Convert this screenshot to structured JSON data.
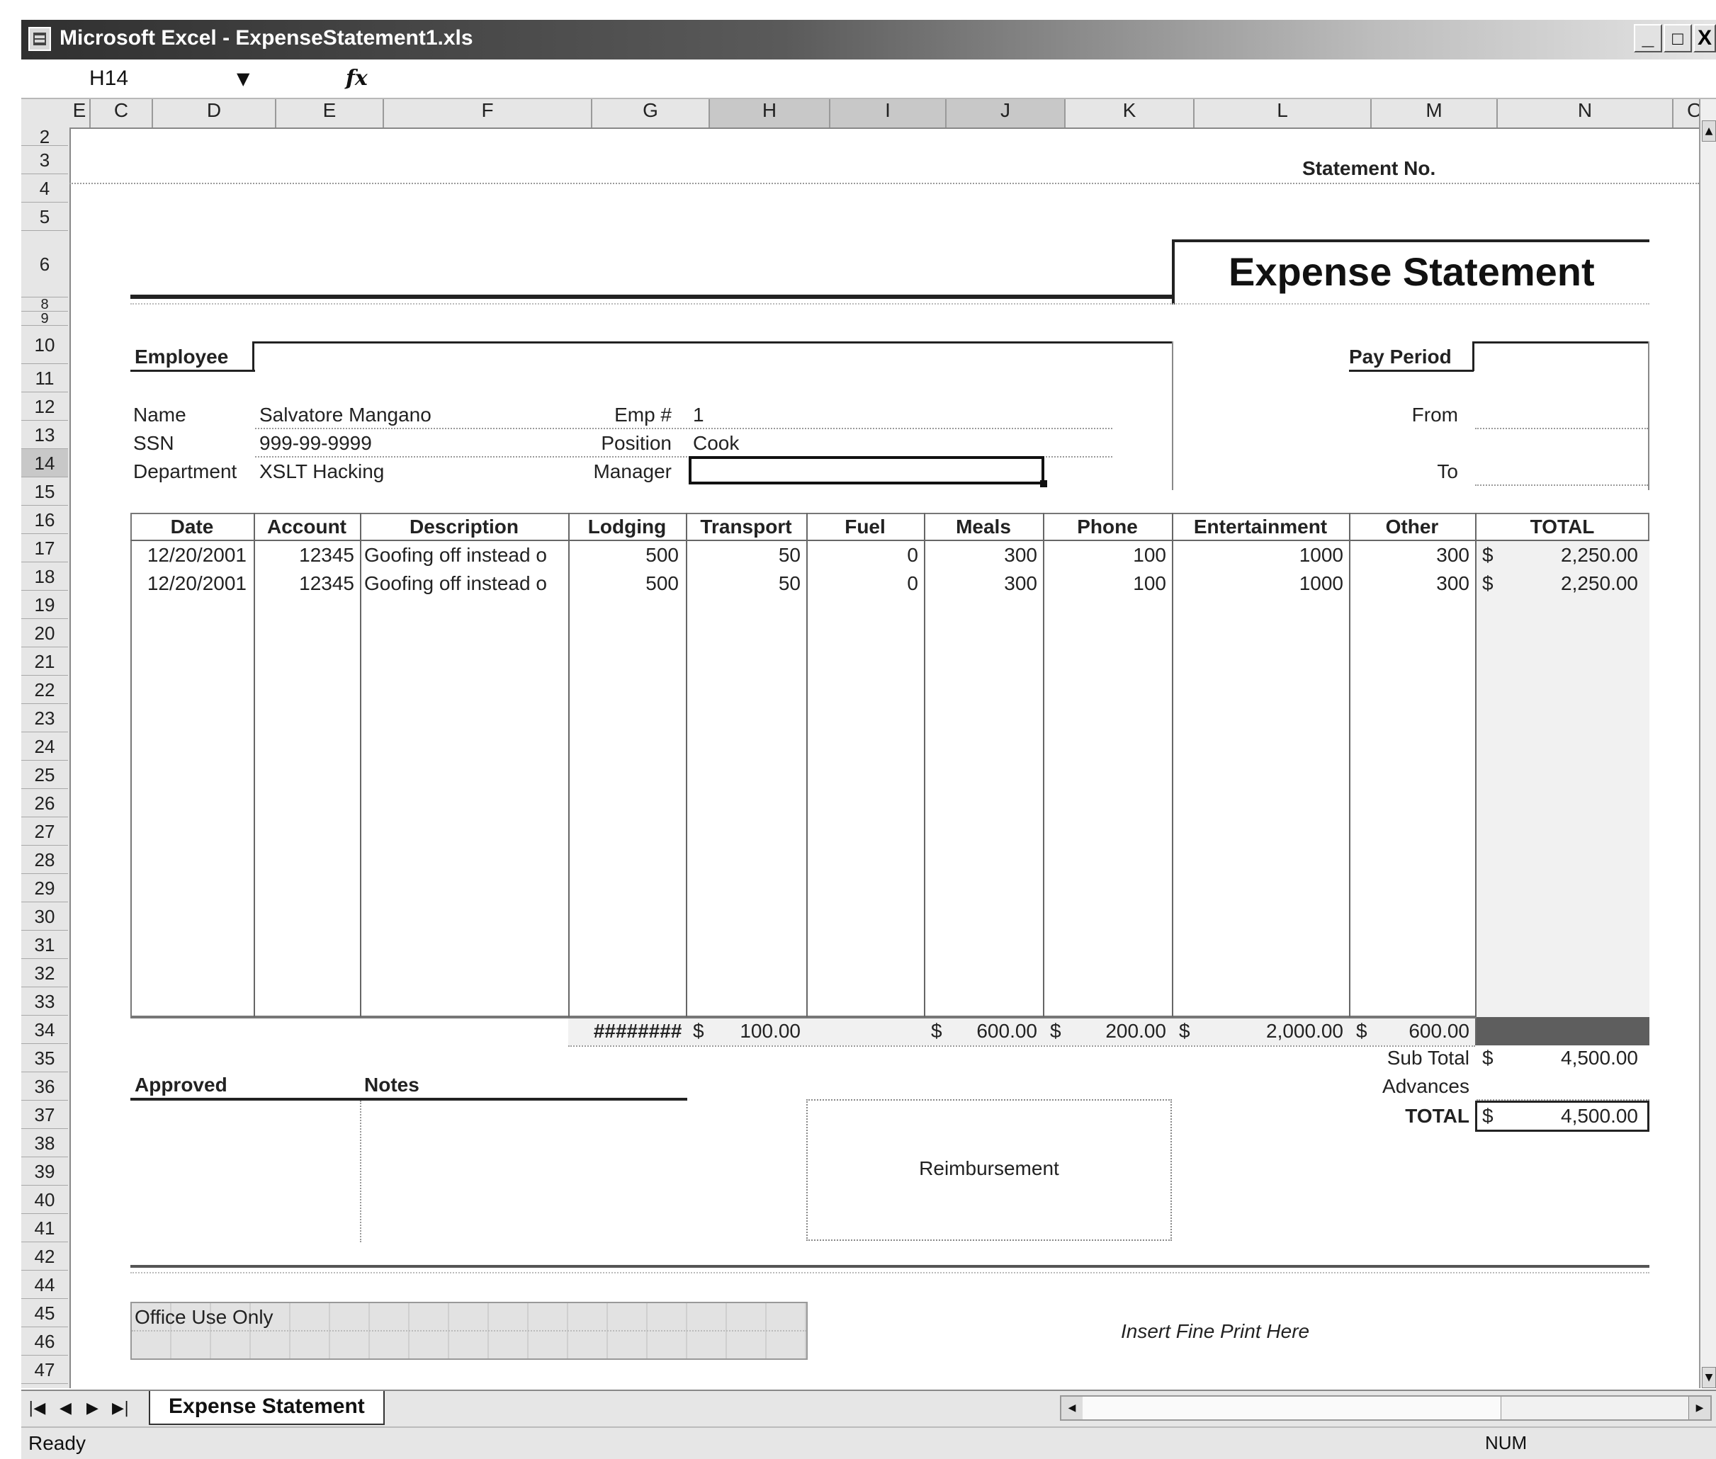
{
  "window": {
    "title": "Microsoft Excel - ExpenseStatement1.xls",
    "minimize_label": "_",
    "maximize_label": "□",
    "close_label": "X"
  },
  "formula_bar": {
    "name_box": "H14",
    "fx_label": "fx",
    "formula": ""
  },
  "columns": [
    "E",
    "C",
    "D",
    "E",
    "F",
    "G",
    "H",
    "I",
    "J",
    "K",
    "L",
    "M",
    "N",
    "O"
  ],
  "rows": [
    "2",
    "3",
    "4",
    "5",
    "6",
    "8",
    "9",
    "10",
    "11",
    "12",
    "13",
    "14",
    "15",
    "16",
    "17",
    "18",
    "19",
    "20",
    "21",
    "22",
    "23",
    "24",
    "25",
    "26",
    "27",
    "28",
    "29",
    "30",
    "31",
    "32",
    "33",
    "34",
    "35",
    "36",
    "37",
    "38",
    "39",
    "40",
    "41",
    "42",
    "44",
    "45",
    "46",
    "47"
  ],
  "sheet": {
    "statement_no_label": "Statement No.",
    "title": "Expense Statement",
    "employee_label": "Employee",
    "pay_period_label": "Pay Period",
    "from_label": "From",
    "to_label": "To",
    "employee": {
      "name_label": "Name",
      "name": "Salvatore Mangano",
      "ssn_label": "SSN",
      "ssn": "999-99-9999",
      "department_label": "Department",
      "department": "XSLT Hacking",
      "emp_no_label": "Emp #",
      "emp_no": "1",
      "position_label": "Position",
      "position": "Cook",
      "manager_label": "Manager",
      "manager": ""
    },
    "table_headers": [
      "Date",
      "Account",
      "Description",
      "Lodging",
      "Transport",
      "Fuel",
      "Meals",
      "Phone",
      "Entertainment",
      "Other",
      "TOTAL"
    ],
    "expense_rows": [
      {
        "date": "12/20/2001",
        "account": "12345",
        "description": "Goofing off instead o",
        "lodging": "500",
        "transport": "50",
        "fuel": "0",
        "meals": "300",
        "phone": "100",
        "entertainment": "1000",
        "other": "300",
        "total_currency": "$",
        "total": "2,250.00"
      },
      {
        "date": "12/20/2001",
        "account": "12345",
        "description": "Goofing off instead o",
        "lodging": "500",
        "transport": "50",
        "fuel": "0",
        "meals": "300",
        "phone": "100",
        "entertainment": "1000",
        "other": "300",
        "total_currency": "$",
        "total": "2,250.00"
      }
    ],
    "totals_row": {
      "lodging": "########",
      "transport_currency": "$",
      "transport": "100.00",
      "meals_currency": "$",
      "meals": "600.00",
      "phone_currency": "$",
      "phone": "200.00",
      "entertainment_currency": "$",
      "entertainment": "2,000.00",
      "other_currency": "$",
      "other": "600.00"
    },
    "subtotal_label": "Sub Total",
    "subtotal_currency": "$",
    "subtotal": "4,500.00",
    "advances_label": "Advances",
    "total_label": "TOTAL",
    "total_currency": "$",
    "total": "4,500.00",
    "approved_label": "Approved",
    "notes_label": "Notes",
    "reimbursement_label": "Reimbursement",
    "office_use_label": "Office Use Only",
    "fine_print": "Insert Fine Print Here"
  },
  "tabs": {
    "active": "Expense Statement"
  },
  "status": {
    "ready": "Ready",
    "num": "NUM"
  }
}
